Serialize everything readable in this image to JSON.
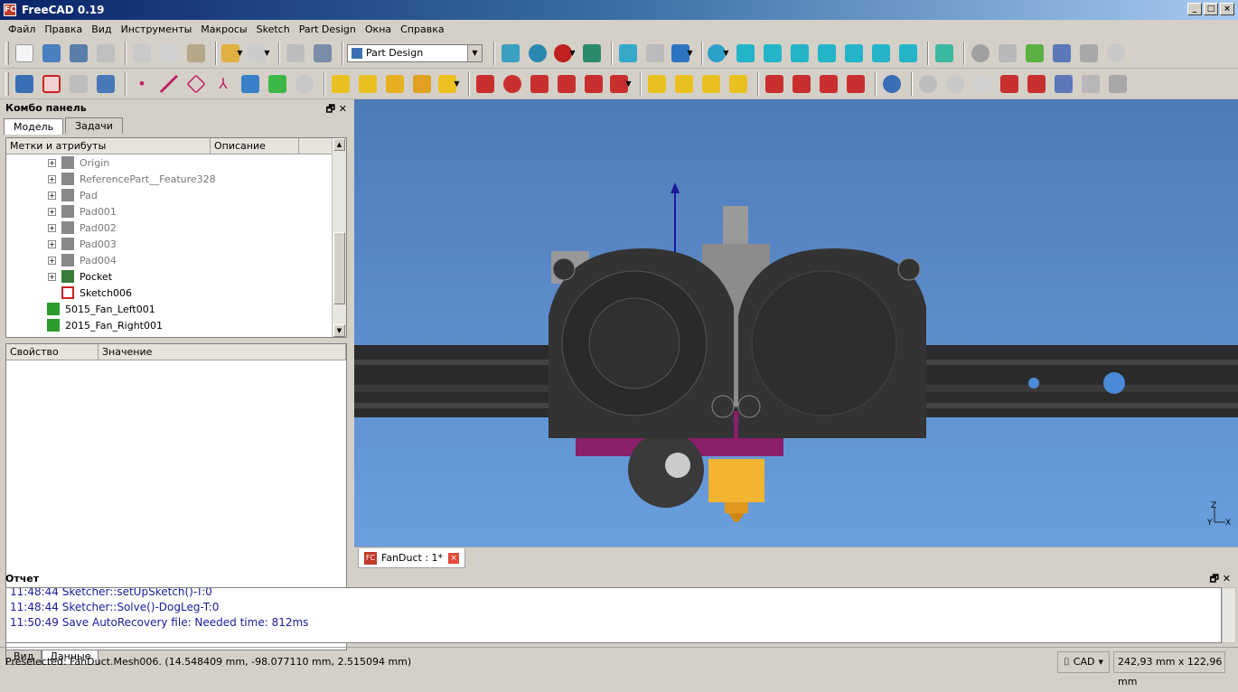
{
  "window": {
    "title": "FreeCAD 0.19",
    "app_icon_text": "FC",
    "minimize": "_",
    "restore": "□",
    "close": "×"
  },
  "menubar": [
    "Файл",
    "Правка",
    "Вид",
    "Инструменты",
    "Макросы",
    "Sketch",
    "Part Design",
    "Окна",
    "Справка"
  ],
  "toolbar": {
    "workbench": "Part Design"
  },
  "combo": {
    "title": "Комбо панель",
    "tabs": [
      "Модель",
      "Задачи"
    ],
    "tree_columns": [
      "Метки и атрибуты",
      "Описание"
    ],
    "tree_items": [
      {
        "label": "Origin",
        "dim": true,
        "icon": "origin-icon",
        "color": "#888888"
      },
      {
        "label": "ReferencePart__Feature328",
        "dim": true,
        "icon": "shape-icon",
        "color": "#888888"
      },
      {
        "label": "Pad",
        "dim": true,
        "icon": "pad-icon",
        "color": "#888888"
      },
      {
        "label": "Pad001",
        "dim": true,
        "icon": "pad-icon",
        "color": "#888888"
      },
      {
        "label": "Pad002",
        "dim": true,
        "icon": "pad-icon",
        "color": "#888888"
      },
      {
        "label": "Pad003",
        "dim": true,
        "icon": "pad-icon",
        "color": "#888888"
      },
      {
        "label": "Pad004",
        "dim": true,
        "icon": "pad-icon",
        "color": "#888888"
      },
      {
        "label": "Pocket",
        "dim": false,
        "icon": "pocket-icon",
        "color": "#3a7a3a"
      },
      {
        "label": "Sketch006",
        "dim": false,
        "icon": "sketch-icon",
        "color": "#cc2222"
      },
      {
        "label": "5015_Fan_Left001",
        "dim": false,
        "icon": "mesh-icon",
        "color": "#2c9a2c"
      },
      {
        "label": "2015_Fan_Right001",
        "dim": false,
        "icon": "mesh-icon",
        "color": "#2c9a2c"
      }
    ],
    "prop_columns": [
      "Свойство",
      "Значение"
    ],
    "bottom_tabs": [
      "Вид",
      "Данные"
    ]
  },
  "document_tab": {
    "label": "FanDuct : 1*",
    "icon_text": "FC",
    "close": "×"
  },
  "report": {
    "title": "Отчет",
    "lines": [
      "11:48:44  Sketcher::setUpSketch()-T:0",
      "11:48:44  Sketcher::Solve()-DogLeg-T:0",
      "11:50:49  Save AutoRecovery file: Needed time: 812ms"
    ]
  },
  "status": {
    "message": "Preselected: FanDuct.Mesh006. (14.548409 mm, -98.077110 mm, 2.515094 mm)",
    "nav_style": "CAD",
    "dimensions": "242,93 mm x 122,96 mm"
  },
  "axis": {
    "z": "Z",
    "x": "X",
    "y": "Y"
  },
  "colors": {
    "viewport_top": "#4f7ab8",
    "viewport_bottom": "#6a9fde",
    "fan": "#333333",
    "extrusion": "#2b2b2b",
    "nozzle": "#f2b431",
    "duct": "#8a1f6a"
  }
}
